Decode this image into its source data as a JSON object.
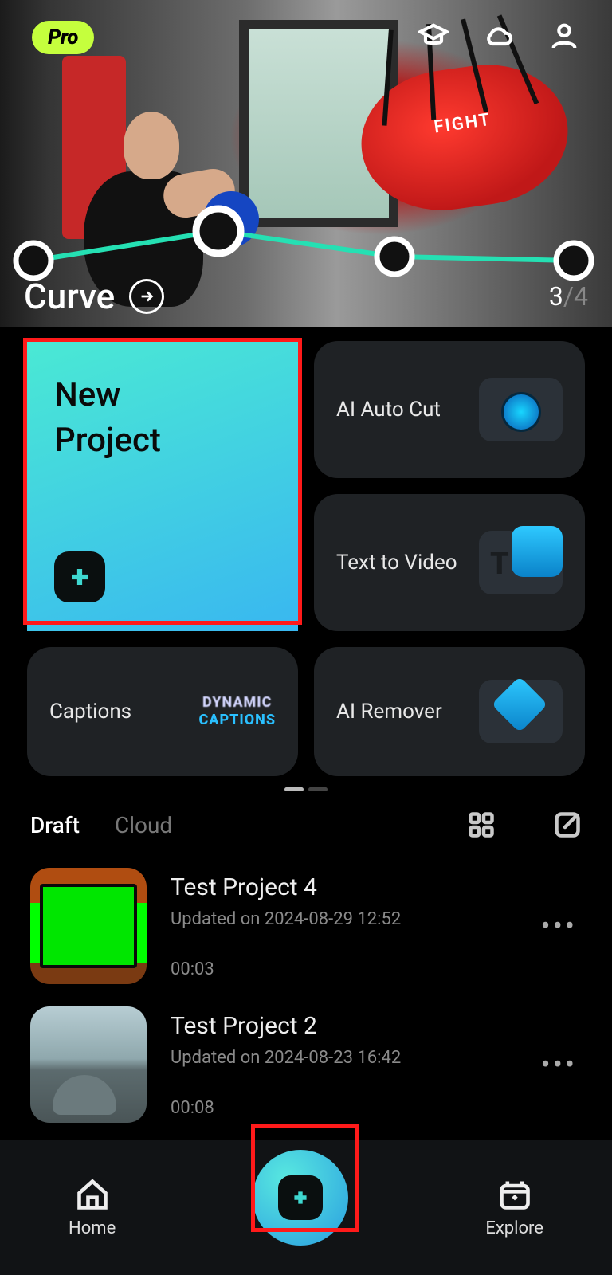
{
  "header": {
    "pro_badge": "Pro",
    "banner": {
      "title": "Curve",
      "page_current": "3",
      "page_separator": "/",
      "page_total": "4"
    }
  },
  "features": {
    "new_project": "New\nProject",
    "ai_auto_cut": "AI Auto Cut",
    "text_to_video": "Text to Video",
    "captions": "Captions",
    "captions_badge_line1": "DYNAMIC",
    "captions_badge_line2": "CAPTIONS",
    "ai_remover": "AI Remover"
  },
  "tabs": {
    "draft": "Draft",
    "cloud": "Cloud",
    "active": "draft"
  },
  "projects": [
    {
      "title": "Test Project 4",
      "updated": "Updated on 2024-08-29 12:52",
      "duration": "00:03"
    },
    {
      "title": "Test Project 2",
      "updated": "Updated on 2024-08-23 16:42",
      "duration": "00:08"
    }
  ],
  "nav": {
    "home": "Home",
    "explore": "Explore"
  }
}
